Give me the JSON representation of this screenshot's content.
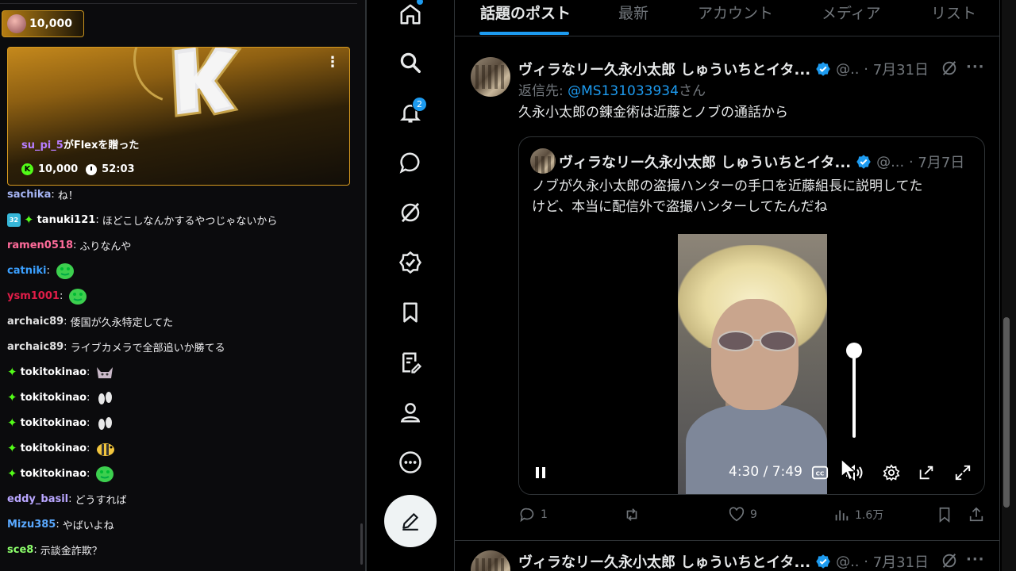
{
  "chat": {
    "pinned_amount": "10,000",
    "gift": {
      "username": "su_pi_5",
      "text": "がFlexを贈った",
      "k_icon": "K",
      "amount": "10,000",
      "duration": "52:03",
      "menu": "⋮"
    },
    "messages": [
      {
        "user": "sachika",
        "color": "#a5b4f3",
        "text": "ね！",
        "emote": ""
      },
      {
        "user": "tanuki121",
        "color": "#ffffff",
        "text": "ほどこしなんかするやつじゃないから",
        "badge": "32",
        "spark": true,
        "emote": ""
      },
      {
        "user": "ramen0518",
        "color": "#ff6b9a",
        "text": "ふりなんや",
        "emote": ""
      },
      {
        "user": "catniki",
        "color": "#3ba0ff",
        "text": "",
        "emote": "green-blob"
      },
      {
        "user": "ysm1001",
        "color": "#e11d48",
        "text": "",
        "emote": "green-blob"
      },
      {
        "user": "archaic89",
        "color": "#e0e0e0",
        "text": "倭国が久永特定してた",
        "emote": ""
      },
      {
        "user": "archaic89",
        "color": "#e0e0e0",
        "text": "ライブカメラで全部追いか勝てる",
        "emote": ""
      },
      {
        "user": "tokitokinao",
        "color": "#ffffff",
        "text": "",
        "spark": true,
        "emote": "cat"
      },
      {
        "user": "tokitokinao",
        "color": "#ffffff",
        "text": "",
        "spark": true,
        "emote": "feet"
      },
      {
        "user": "tokitokinao",
        "color": "#ffffff",
        "text": "",
        "spark": true,
        "emote": "feet"
      },
      {
        "user": "tokitokinao",
        "color": "#ffffff",
        "text": "",
        "spark": true,
        "emote": "bee"
      },
      {
        "user": "tokitokinao",
        "color": "#ffffff",
        "text": "",
        "spark": true,
        "emote": "green-blob"
      },
      {
        "user": "eddy_basil",
        "color": "#b9a6ff",
        "text": "どうすれば",
        "emote": ""
      },
      {
        "user": "Mizu385",
        "color": "#5aa9ff",
        "text": "やばいよね",
        "emote": ""
      },
      {
        "user": "sce8",
        "color": "#8cff6b",
        "text": "示談金詐欺？",
        "emote": ""
      }
    ]
  },
  "nav": {
    "notification_count": "2",
    "icons": [
      "home-icon",
      "search-icon",
      "bell-icon",
      "message-icon",
      "grok-icon",
      "verified-icon",
      "bookmark-icon",
      "lists-icon",
      "profile-icon",
      "more-icon",
      "compose-icon"
    ]
  },
  "tabs": [
    "話題のポスト",
    "最新",
    "アカウント",
    "メディア",
    "リスト"
  ],
  "post": {
    "author": "ヴィラなリー久永小太郎 しゅういちとイタ...",
    "handle": "@..",
    "date": "7月31日",
    "reply_prefix": "返信先: ",
    "reply_mention": "@MS131033934",
    "reply_suffix": "さん",
    "text": "久永小太郎の錬金術は近藤とノブの通話から",
    "quote": {
      "author": "ヴィラなリー久永小太郎 しゅういちとイタ...",
      "handle": "@...",
      "date": "7月7日",
      "text_line1": "ノブが久永小太郎の盗撮ハンターの手口を近藤組長に説明してた",
      "text_line2": "けど、本当に配信外で盗撮ハンターしてたんだね",
      "video_time": "4:30 / 7:49",
      "volume_level": 1.0
    },
    "stats": {
      "replies": "1",
      "retweets": "",
      "likes": "9",
      "views": "1.6万"
    }
  },
  "next_post": {
    "author": "ヴィラなリー久永小太郎 しゅういちとイタ...",
    "handle": "@..",
    "date": "7月31日"
  }
}
